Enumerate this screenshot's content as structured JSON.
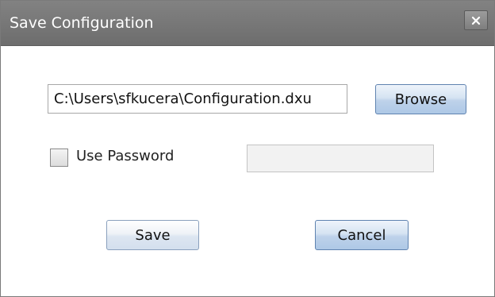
{
  "dialog": {
    "title": "Save Configuration",
    "close_icon": "close-icon"
  },
  "form": {
    "file_path": "C:\\Users\\sfkucera\\Configuration.dxu",
    "browse_label": "Browse",
    "use_password_label": "Use Password",
    "use_password_checked": false,
    "password_value": "",
    "save_label": "Save",
    "cancel_label": "Cancel"
  },
  "colors": {
    "titlebar": "#777777",
    "button_accent": "#c2d3e8"
  }
}
